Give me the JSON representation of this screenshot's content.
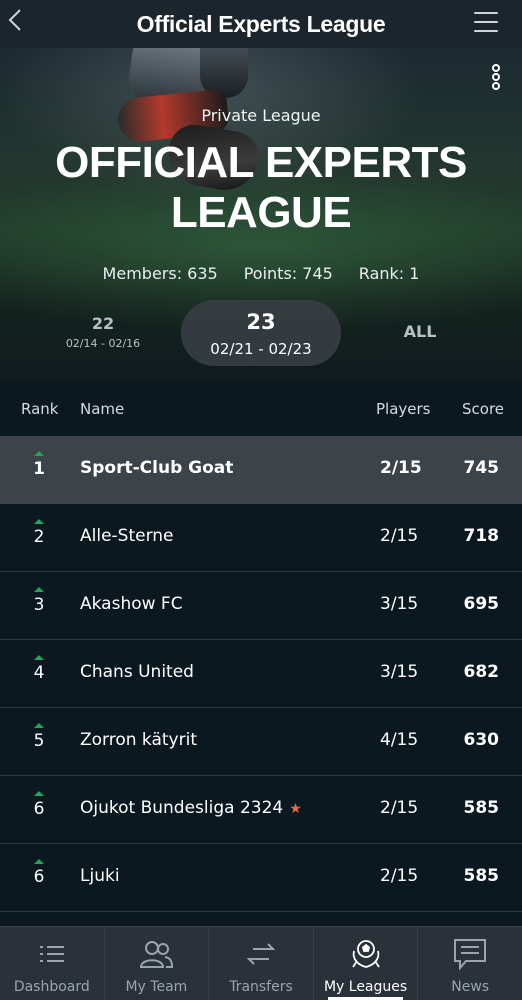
{
  "header": {
    "title": "Official Experts League",
    "back_icon": "chevron-left-icon",
    "menu_icon": "hamburger-menu-icon"
  },
  "hero": {
    "subtitle": "Private League",
    "title": "OFFICIAL EXPERTS LEAGUE",
    "stats": {
      "members": "Members: 635",
      "points": "Points: 745",
      "rank": "Rank: 1"
    },
    "weeks": {
      "prev": {
        "num": "22",
        "range": "02/14 - 02/16"
      },
      "current": {
        "num": "23",
        "range": "02/21 - 02/23"
      },
      "all": "ALL"
    }
  },
  "table": {
    "headers": {
      "rank": "Rank",
      "name": "Name",
      "players": "Players",
      "score": "Score"
    },
    "rows": [
      {
        "rank": "1",
        "name": "Sport-Club Goat",
        "players": "2/15",
        "score": "745"
      },
      {
        "rank": "2",
        "name": "Alle-Sterne",
        "players": "2/15",
        "score": "718"
      },
      {
        "rank": "3",
        "name": "Akashow FC",
        "players": "3/15",
        "score": "695"
      },
      {
        "rank": "4",
        "name": "Chans United",
        "players": "3/15",
        "score": "682"
      },
      {
        "rank": "5",
        "name": "Zorron kätyrit",
        "players": "4/15",
        "score": "630"
      },
      {
        "rank": "6",
        "name": "Ojukot Bundesliga 2324",
        "players": "2/15",
        "score": "585"
      },
      {
        "rank": "6",
        "name": "Ljuki",
        "players": "2/15",
        "score": "585"
      }
    ],
    "star_row_color": "#ee6a36",
    "up_arrow_color": "#20a55a"
  },
  "tabbar": {
    "tabs": [
      {
        "label": "Dashboard",
        "icon": "list-icon"
      },
      {
        "label": "My Team",
        "icon": "users-icon"
      },
      {
        "label": "Transfers",
        "icon": "transfer-arrows-icon"
      },
      {
        "label": "My Leagues",
        "icon": "trophy-ball-icon",
        "active": true
      },
      {
        "label": "News",
        "icon": "news-message-icon"
      }
    ]
  }
}
